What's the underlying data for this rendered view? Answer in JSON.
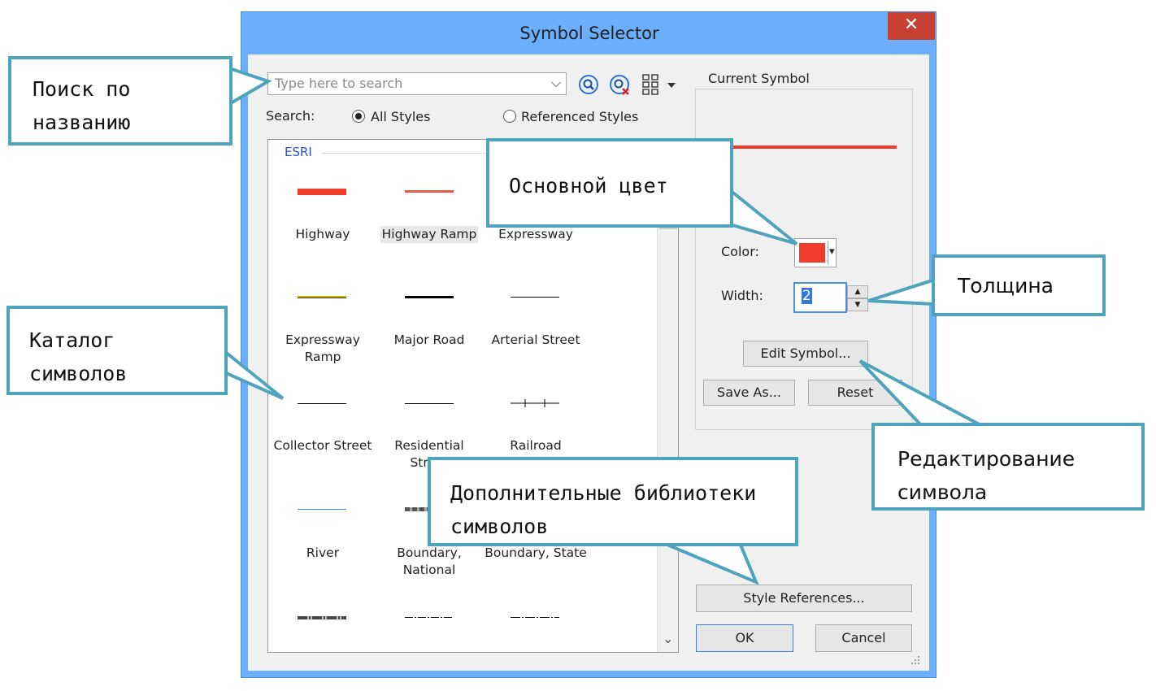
{
  "window": {
    "title": "Symbol Selector",
    "close_glyph": "✕"
  },
  "search": {
    "placeholder": "Type here to search",
    "dropdown_glyph": "⌵",
    "label": "Search:",
    "option_all": "All Styles",
    "option_referenced": "Referenced Styles",
    "selected": "All Styles"
  },
  "gallery": {
    "group_title": "ESRI",
    "items": [
      {
        "label": "Highway",
        "color": "#f03c2a"
      },
      {
        "label": "Highway Ramp",
        "color": "#e65c4c"
      },
      {
        "label": "Expressway",
        "color": "#f03c2a"
      },
      {
        "label": "Expressway Ramp",
        "color": "#c8b400"
      },
      {
        "label": "Major Road",
        "color": "#000000"
      },
      {
        "label": "Arterial Street",
        "color": "#000000"
      },
      {
        "label": "Collector Street",
        "color": "#000000"
      },
      {
        "label": "Residential Street",
        "color": "#000000"
      },
      {
        "label": "Railroad",
        "color": "#000000"
      },
      {
        "label": "River",
        "color": "#3a8fe8"
      },
      {
        "label": "Boundary, National",
        "color": "#555555"
      },
      {
        "label": "Boundary, State",
        "color": "#000000"
      }
    ],
    "scroll_down_glyph": "⌄"
  },
  "current_symbol": {
    "group_title": "Current Symbol",
    "color_label": "Color:",
    "color_value": "#f03c2a",
    "width_label": "Width:",
    "width_value": "2",
    "spin_up": "▲",
    "spin_down": "▼",
    "dropdown_glyph": "▾"
  },
  "buttons": {
    "edit_symbol": "Edit Symbol...",
    "save_as": "Save As...",
    "reset": "Reset",
    "style_references": "Style References...",
    "ok": "OK",
    "cancel": "Cancel"
  },
  "callouts": {
    "search_by_name": "Поиск по названию",
    "main_color": "Основной цвет",
    "thickness": "Толщина",
    "symbol_catalog": "Каталог символов",
    "edit_symbol": "Редактирование символа",
    "extra_libraries": "Дополнительные библиотеки символов"
  },
  "colors": {
    "titlebar": "#6aaefc",
    "close": "#c84033",
    "callout_border": "#4fa4bd",
    "symbol_red": "#f03c2a"
  }
}
